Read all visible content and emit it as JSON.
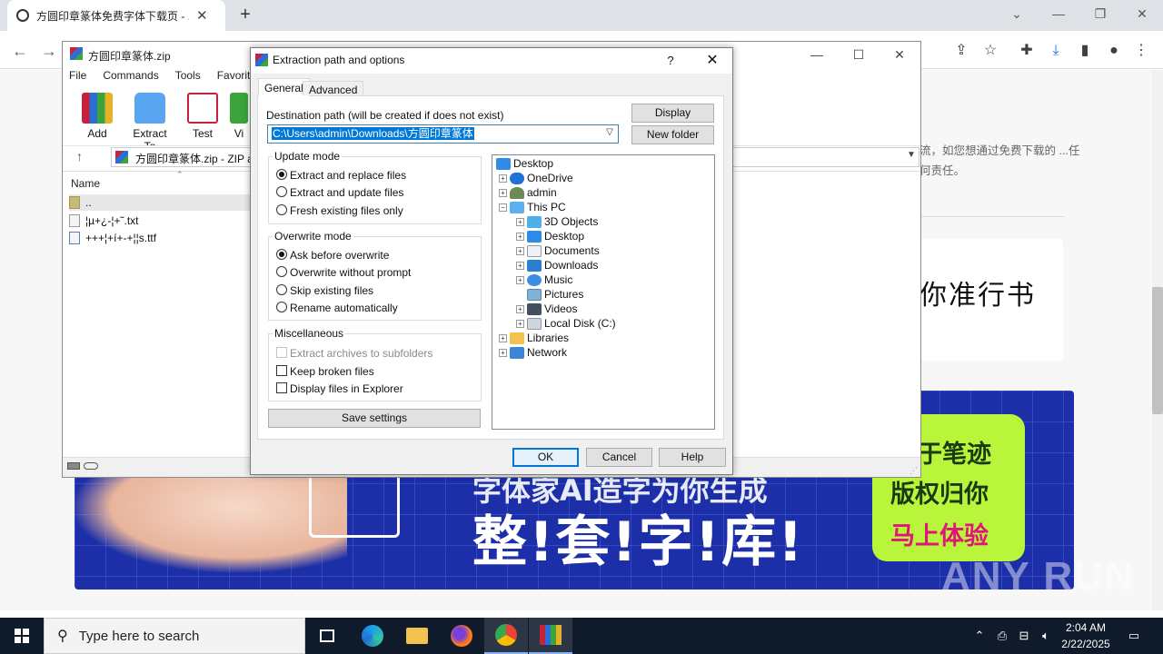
{
  "browser": {
    "tab_title": "方圆印章篆体免费字体下载页 - ...",
    "page_text": "流，如您想通过免费下载的 ...任何责任。",
    "card_text": "你准行书",
    "banner": {
      "subline": "字体家AI造字为你生成",
      "headline": "整!套!字!库!",
      "green_lines": [
        "于笔迹",
        "版权归你",
        "马上体验"
      ],
      "watermark": "ANY RUN"
    }
  },
  "winrar": {
    "title": "方圆印章篆体.zip",
    "menu": [
      "File",
      "Commands",
      "Tools",
      "Favorites"
    ],
    "tools": [
      "Add",
      "Extract To",
      "Test",
      "Vi"
    ],
    "path": "方圆印章篆体.zip - ZIP a",
    "column_name": "Name",
    "files": [
      "..",
      "¦µ+¿-¦+˜.txt",
      "+++¦+í+-+¦¦s.ttf"
    ]
  },
  "dialog": {
    "title": "Extraction path and options",
    "help": "?",
    "tabs": [
      "General",
      "Advanced"
    ],
    "dest_label": "Destination path (will be created if does not exist)",
    "dest_value": "C:\\Users\\admin\\Downloads\\方圆印章篆体",
    "display_btn": "Display",
    "new_folder_btn": "New folder",
    "update_mode": {
      "title": "Update mode",
      "options": [
        "Extract and replace files",
        "Extract and update files",
        "Fresh existing files only"
      ],
      "selected": 0
    },
    "overwrite_mode": {
      "title": "Overwrite mode",
      "options": [
        "Ask before overwrite",
        "Overwrite without prompt",
        "Skip existing files",
        "Rename automatically"
      ],
      "selected": 0
    },
    "misc": {
      "title": "Miscellaneous",
      "options": [
        "Extract archives to subfolders",
        "Keep broken files",
        "Display files in Explorer"
      ]
    },
    "save_settings": "Save settings",
    "tree": [
      "Desktop",
      "OneDrive",
      "admin",
      "This PC",
      "3D Objects",
      "Desktop",
      "Documents",
      "Downloads",
      "Music",
      "Pictures",
      "Videos",
      "Local Disk (C:)",
      "Libraries",
      "Network"
    ],
    "ok": "OK",
    "cancel": "Cancel",
    "help_btn": "Help"
  },
  "taskbar": {
    "search_placeholder": "Type here to search",
    "time": "2:04 AM",
    "date": "2/22/2025"
  },
  "colors": {
    "accent": "#0078d7",
    "taskbar": "#0f1b2b",
    "banner_blue": "#1c2fa8",
    "banner_green": "#b9f53a"
  }
}
